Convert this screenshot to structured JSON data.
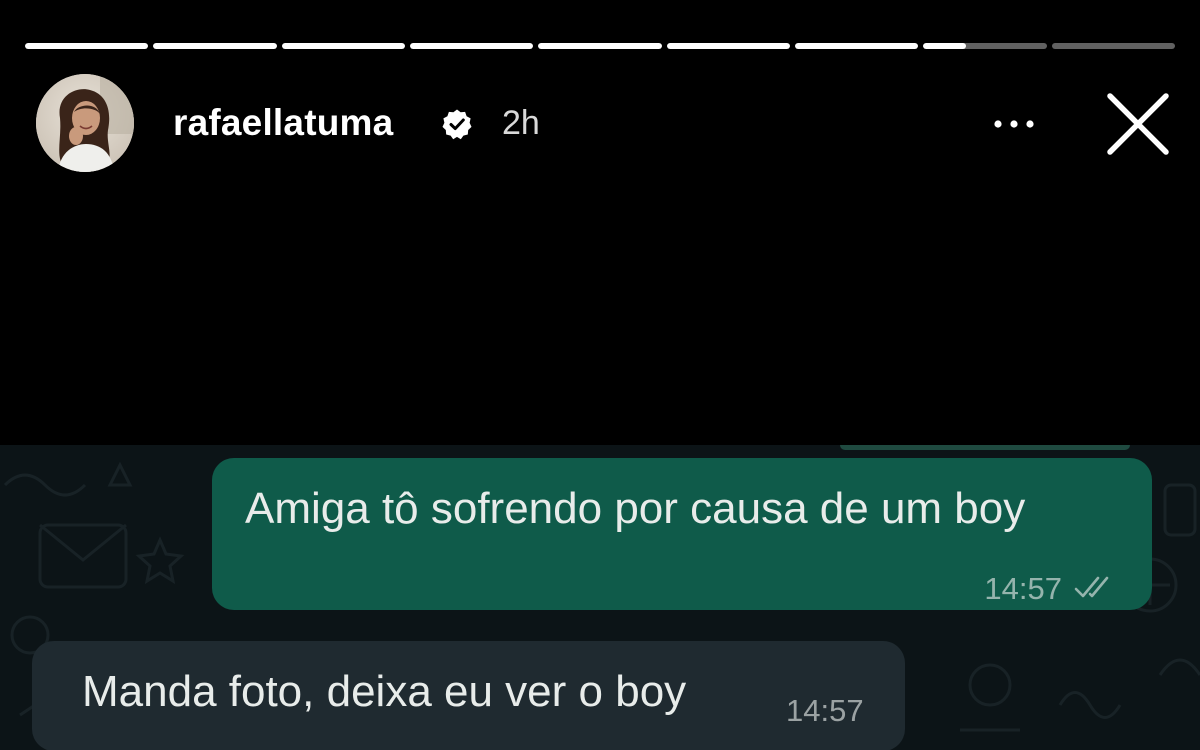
{
  "story": {
    "progress_segments": [
      1,
      1,
      1,
      1,
      1,
      1,
      1,
      0.35,
      0
    ],
    "username": "rafaellatuma",
    "verified": true,
    "time_ago": "2h",
    "icons": {
      "verified": "verified-badge-icon",
      "more": "more-options-icon",
      "close": "close-icon"
    }
  },
  "chat": {
    "messages": [
      {
        "direction": "outgoing",
        "text": "Amiga tô sofrendo por causa de um boy",
        "time": "14:57",
        "status": "read-double-check"
      },
      {
        "direction": "incoming",
        "text": "Manda foto, deixa eu ver o boy",
        "time": "14:57"
      }
    ],
    "colors": {
      "background": "#0c1417",
      "outgoing_bubble": "#0f5b4a",
      "incoming_bubble": "#1f2a30"
    }
  }
}
